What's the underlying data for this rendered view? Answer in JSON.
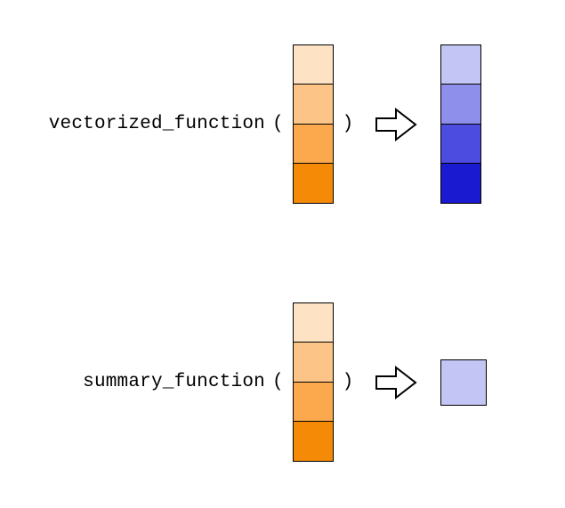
{
  "rows": [
    {
      "label": "vectorized_function",
      "open_paren": "(",
      "close_paren": ")",
      "input_colors": [
        "#FDE2C4",
        "#FCC487",
        "#FBA94C",
        "#F58A07"
      ],
      "output_type": "column",
      "output_colors": [
        "#C3C6F4",
        "#8E8EEB",
        "#4C4CE0",
        "#1A1AD0"
      ]
    },
    {
      "label": "summary_function",
      "open_paren": "(",
      "close_paren": ")",
      "input_colors": [
        "#FDE2C4",
        "#FCC487",
        "#FBA94C",
        "#F58A07"
      ],
      "output_type": "single",
      "output_colors": [
        "#C3C6F4"
      ]
    }
  ],
  "layout": {
    "cell_size_px": 46,
    "arrow_color": "#000000"
  }
}
